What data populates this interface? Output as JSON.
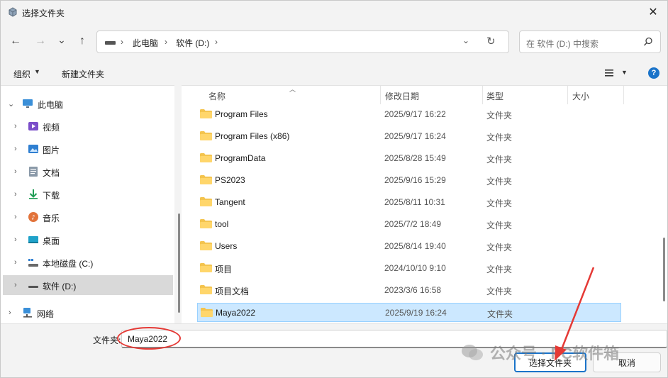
{
  "window": {
    "title": "选择文件夹",
    "close_glyph": "✕"
  },
  "nav": {
    "back_glyph": "←",
    "forward_glyph": "→",
    "recent_glyph": "⌄",
    "up_glyph": "↑",
    "address": {
      "crumbs": [
        "此电脑",
        "软件 (D:)"
      ],
      "separator": "›"
    },
    "search_placeholder": "在 软件 (D:) 中搜索"
  },
  "toolbar": {
    "organize_label": "组织",
    "new_folder_label": "新建文件夹",
    "help_glyph": "?"
  },
  "tree": [
    {
      "label": "此电脑",
      "icon": "computer-icon",
      "expanded": true
    },
    {
      "label": "视频",
      "icon": "video-icon"
    },
    {
      "label": "图片",
      "icon": "pictures-icon"
    },
    {
      "label": "文档",
      "icon": "documents-icon"
    },
    {
      "label": "下载",
      "icon": "download-icon"
    },
    {
      "label": "音乐",
      "icon": "music-icon"
    },
    {
      "label": "桌面",
      "icon": "desktop-icon"
    },
    {
      "label": "本地磁盘 (C:)",
      "icon": "drive-icon"
    },
    {
      "label": "软件 (D:)",
      "icon": "drive-icon",
      "selected": true
    },
    {
      "label": "网络",
      "icon": "network-icon"
    }
  ],
  "columns": {
    "name": "名称",
    "modified": "修改日期",
    "type": "类型",
    "size": "大小"
  },
  "files": [
    {
      "name": "Program Files",
      "modified": "2025/9/17 16:22",
      "type": "文件夹"
    },
    {
      "name": "Program Files (x86)",
      "modified": "2025/9/17 16:24",
      "type": "文件夹"
    },
    {
      "name": "ProgramData",
      "modified": "2025/8/28 15:49",
      "type": "文件夹"
    },
    {
      "name": "PS2023",
      "modified": "2025/9/16 15:29",
      "type": "文件夹"
    },
    {
      "name": "Tangent",
      "modified": "2025/8/11 10:31",
      "type": "文件夹"
    },
    {
      "name": "tool",
      "modified": "2025/7/2 18:49",
      "type": "文件夹"
    },
    {
      "name": "Users",
      "modified": "2025/8/14 19:40",
      "type": "文件夹"
    },
    {
      "name": "项目",
      "modified": "2024/10/10 9:10",
      "type": "文件夹"
    },
    {
      "name": "项目文档",
      "modified": "2023/3/6 16:58",
      "type": "文件夹"
    },
    {
      "name": "Maya2022",
      "modified": "2025/9/19 16:24",
      "type": "文件夹",
      "selected": true
    }
  ],
  "footer": {
    "folder_label": "文件夹:",
    "folder_value": "Maya2022",
    "select_button": "选择文件夹",
    "cancel_button": "取消"
  },
  "watermark": {
    "text": "公众号 · PC软件箱"
  },
  "colors": {
    "accent": "#1a73c9",
    "selection": "#cce8ff",
    "annotation": "#e53935",
    "folder": "#f4c44e"
  }
}
